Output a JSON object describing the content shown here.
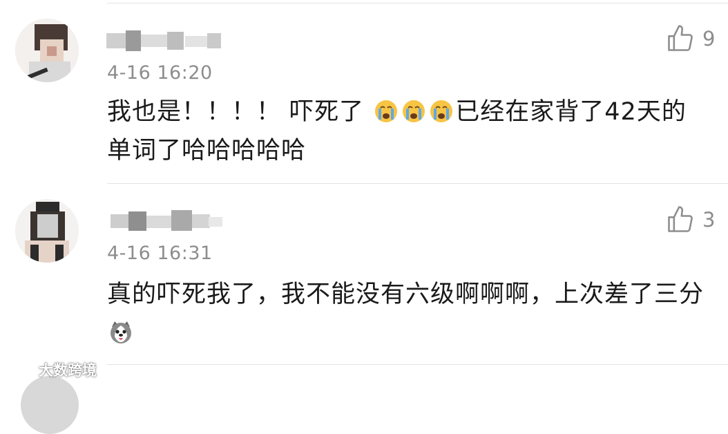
{
  "comments": [
    {
      "time": "4-16 16:20",
      "likes": "9",
      "text_before": "我也是！！！！ 吓死了",
      "emojis": [
        "crying-face-icon",
        "crying-face-icon",
        "crying-face-icon"
      ],
      "text_after": "已经在家背了42天的单词了哈哈哈哈哈"
    },
    {
      "time": "4-16 16:31",
      "likes": "3",
      "text_before": "真的吓死我了，我不能没有六级啊啊啊，上次差了三分",
      "emojis": [
        "husky-face-icon"
      ],
      "text_after": ""
    }
  ],
  "watermark": {
    "text": "大数跨境"
  }
}
